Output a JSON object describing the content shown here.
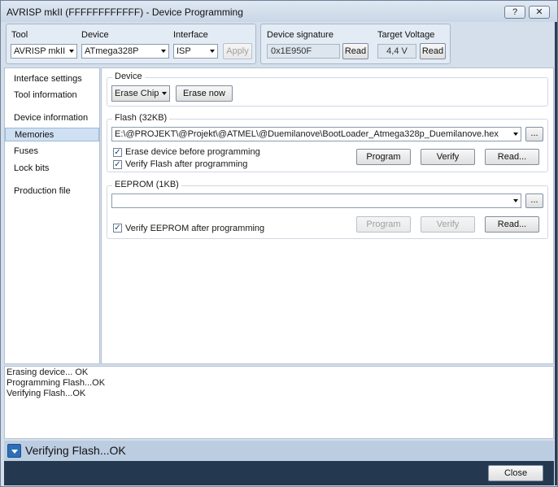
{
  "window": {
    "title": "AVRISP mkII (FFFFFFFFFFFF) - Device Programming",
    "help_label": "?",
    "close_label": "✕"
  },
  "tool_group": {
    "tool_label": "Tool",
    "tool_value": "AVRISP mkII",
    "device_label": "Device",
    "device_value": "ATmega328P",
    "interface_label": "Interface",
    "interface_value": "ISP",
    "apply_label": "Apply"
  },
  "signature_group": {
    "signature_label": "Device signature",
    "signature_value": "0x1E950F",
    "read_signature_label": "Read",
    "voltage_label": "Target Voltage",
    "voltage_value": "4,4 V",
    "read_voltage_label": "Read"
  },
  "sidebar": {
    "items": [
      {
        "label": "Interface settings",
        "selected": false
      },
      {
        "label": "Tool information",
        "selected": false
      },
      {
        "label": "Device information",
        "selected": false
      },
      {
        "label": "Memories",
        "selected": true
      },
      {
        "label": "Fuses",
        "selected": false
      },
      {
        "label": "Lock bits",
        "selected": false
      },
      {
        "label": "Production file",
        "selected": false
      }
    ]
  },
  "device_section": {
    "title": "Device",
    "erase_select": "Erase Chip",
    "erase_now_label": "Erase now"
  },
  "flash_section": {
    "title": "Flash (32KB)",
    "file_path": "E:\\@PROJEKT\\@Projekt\\@ATMEL\\@Duemilanove\\BootLoader_Atmega328p_Duemilanove.hex",
    "browse_label": "...",
    "erase_before_label": "Erase device before programming",
    "erase_before_checked": true,
    "verify_after_label": "Verify Flash after programming",
    "verify_after_checked": true,
    "program_label": "Program",
    "verify_label": "Verify",
    "read_label": "Read..."
  },
  "eeprom_section": {
    "title": "EEPROM (1KB)",
    "file_path": "",
    "browse_label": "...",
    "verify_after_label": "Verify EEPROM after programming",
    "verify_after_checked": true,
    "program_label": "Program",
    "verify_label": "Verify",
    "read_label": "Read..."
  },
  "log": {
    "lines": [
      "Erasing device... OK",
      "Programming Flash...OK",
      "Verifying Flash...OK"
    ]
  },
  "status": {
    "text": "Verifying Flash...OK"
  },
  "footer": {
    "close_label": "Close"
  },
  "colors": {
    "accent": "#2d6fb7",
    "selection": "#cfe0f3",
    "footer": "#243850"
  }
}
